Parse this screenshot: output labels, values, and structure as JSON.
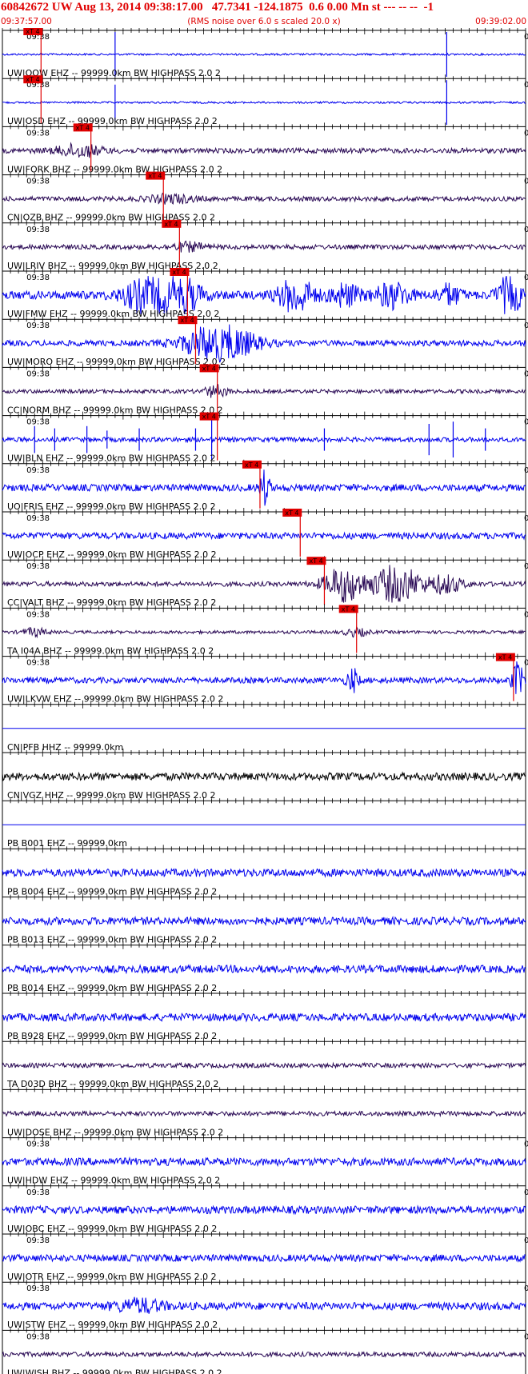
{
  "header": {
    "title": "60842672 UW Aug 13, 2014 09:38:17.00   47.7341 -124.1875  0.6 0.00 Mn st --- -- --  -1",
    "start_time": "09:37:57.00",
    "end_time": "09:39:02.00",
    "subtitle": "(RMS noise over 6.0 s scaled 20.0 x)"
  },
  "chart_data": {
    "type": "seismogram",
    "x_range_seconds": [
      0,
      65
    ],
    "tick_label": "09:38",
    "pick_label": "xT 4",
    "colors": {
      "blue": "#0000ee",
      "dark": "#2a0a55",
      "black": "#000000",
      "pick": "#e00000",
      "axis": "#000000"
    },
    "traces": [
      {
        "label": "UW|OOW EHZ -- 99999.0km BW  HIGHPASS  2.0  2",
        "color": "blue",
        "pick_s": 4.8,
        "amp": 0.05,
        "spikes": [
          [
            14.0,
            1.0
          ],
          [
            55.2,
            1.0
          ]
        ],
        "bursts": []
      },
      {
        "label": "UW|OSD EHZ -- 99999.0km BW  HIGHPASS  2.0  2",
        "color": "blue",
        "pick_s": 4.8,
        "amp": 0.05,
        "spikes": [
          [
            14.0,
            0.8
          ],
          [
            55.2,
            1.0
          ]
        ],
        "bursts": []
      },
      {
        "label": "UW|FORK BHZ -- 99999.0km BW  HIGHPASS  2.0  2",
        "color": "dark",
        "pick_s": 11.0,
        "amp": 0.13,
        "spikes": [],
        "bursts": [
          [
            9.5,
            4.0,
            0.3
          ]
        ]
      },
      {
        "label": "CN|OZB BHZ -- 99999.0km BW  HIGHPASS  2.0  2",
        "color": "dark",
        "pick_s": 20.0,
        "amp": 0.12,
        "spikes": [],
        "bursts": [
          [
            21.0,
            4.0,
            0.2
          ]
        ]
      },
      {
        "label": "UW|LRIV BHZ -- 99999.0km BW  HIGHPASS  2.0  2",
        "color": "dark",
        "pick_s": 22.0,
        "amp": 0.12,
        "spikes": [],
        "bursts": [
          [
            23.0,
            3.0,
            0.2
          ]
        ]
      },
      {
        "label": "UW|FMW EHZ -- 99999.0km BW  HIGHPASS  2.0  2",
        "color": "blue",
        "pick_s": 23.0,
        "amp": 0.22,
        "spikes": [],
        "bursts": [
          [
            18.0,
            4.0,
            0.9
          ],
          [
            22.0,
            3.5,
            1.0
          ],
          [
            36.5,
            3.0,
            0.9
          ],
          [
            42.5,
            2.5,
            0.55
          ],
          [
            48.5,
            3.0,
            0.6
          ],
          [
            55.5,
            2.0,
            0.5
          ],
          [
            63.0,
            2.0,
            1.0
          ]
        ]
      },
      {
        "label": "UW|MORO EHZ -- 99999.0km BW  HIGHPASS  2.0  2",
        "color": "blue",
        "pick_s": 24.0,
        "amp": 0.15,
        "spikes": [],
        "bursts": [
          [
            27.0,
            6.0,
            1.0
          ]
        ]
      },
      {
        "label": "CC|NORM BHZ -- 99999.0km BW  HIGHPASS  2.0  2",
        "color": "dark",
        "pick_s": 26.7,
        "amp": 0.1,
        "spikes": [],
        "bursts": [
          [
            26.5,
            2.0,
            0.3
          ]
        ]
      },
      {
        "label": "UW|BLN EHZ -- 99999.0km BW  HIGHPASS  2.0  2",
        "color": "blue",
        "pick_s": 26.7,
        "amp": 0.12,
        "spikes": [
          [
            4.0,
            0.6
          ],
          [
            6.5,
            0.5
          ],
          [
            10.5,
            0.6
          ],
          [
            13.0,
            0.4
          ],
          [
            17.0,
            0.5
          ],
          [
            24.0,
            0.5
          ],
          [
            26.0,
            0.9
          ],
          [
            40.0,
            0.5
          ],
          [
            53.0,
            0.7
          ],
          [
            56.0,
            0.8
          ],
          [
            60.0,
            0.5
          ]
        ],
        "bursts": []
      },
      {
        "label": "UO|FRIS EHZ -- 99999.0km BW  HIGHPASS  2.0  2",
        "color": "blue",
        "pick_s": 32.0,
        "amp": 0.18,
        "spikes": [],
        "bursts": [
          [
            32.6,
            0.8,
            1.0
          ]
        ]
      },
      {
        "label": "UW|OCP EHZ -- 99999.0km BW  HIGHPASS  2.0  2",
        "color": "blue",
        "pick_s": 37.0,
        "amp": 0.17,
        "spikes": [],
        "bursts": []
      },
      {
        "label": "CC|VALT BHZ -- 99999.0km BW  HIGHPASS  2.0  2",
        "color": "dark",
        "pick_s": 40.0,
        "amp": 0.12,
        "spikes": [],
        "bursts": [
          [
            42.5,
            3.5,
            0.9
          ],
          [
            49.0,
            4.0,
            1.0
          ],
          [
            55.0,
            3.0,
            0.45
          ]
        ]
      },
      {
        "label": "TA I04A BHZ -- 99999.0km BW  HIGHPASS  2.0  2",
        "color": "dark",
        "pick_s": 44.0,
        "amp": 0.08,
        "spikes": [],
        "bursts": [
          [
            4.0,
            2.0,
            0.2
          ],
          [
            44.0,
            2.0,
            0.2
          ]
        ]
      },
      {
        "label": "UW|LKVW EHZ -- 99999.0km BW  HIGHPASS  2.0  2",
        "color": "blue",
        "pick_s": 63.5,
        "amp": 0.15,
        "spikes": [],
        "bursts": [
          [
            43.5,
            1.0,
            0.6
          ],
          [
            64.0,
            1.0,
            0.9
          ]
        ]
      },
      {
        "label": "CN|PFB HHZ -- 99999.0km",
        "color": "blue",
        "pick_s": null,
        "amp": 0.0,
        "spikes": [],
        "bursts": [],
        "hide_tick": true
      },
      {
        "label": "CN|VGZ HHZ -- 99999.0km BW  HIGHPASS  2.0  2",
        "color": "black",
        "pick_s": null,
        "amp": 0.2,
        "spikes": [],
        "bursts": [],
        "hide_tick": true
      },
      {
        "label": "PB B001 EHZ -- 99999.0km",
        "color": "blue",
        "pick_s": null,
        "amp": 0.0,
        "spikes": [],
        "bursts": [],
        "hide_tick": true
      },
      {
        "label": "PB B004 EHZ -- 99999.0km BW  HIGHPASS  2.0  2",
        "color": "blue",
        "pick_s": null,
        "amp": 0.2,
        "spikes": [],
        "bursts": [],
        "hide_tick": true
      },
      {
        "label": "PB B013 EHZ -- 99999.0km BW  HIGHPASS  2.0  2",
        "color": "blue",
        "pick_s": null,
        "amp": 0.2,
        "spikes": [],
        "bursts": [],
        "hide_tick": true
      },
      {
        "label": "PB B014 EHZ -- 99999.0km BW  HIGHPASS  2.0  2",
        "color": "blue",
        "pick_s": null,
        "amp": 0.2,
        "spikes": [],
        "bursts": [],
        "hide_tick": true
      },
      {
        "label": "PB B928 EHZ -- 99999.0km BW  HIGHPASS  2.0  2",
        "color": "blue",
        "pick_s": null,
        "amp": 0.2,
        "spikes": [],
        "bursts": [],
        "hide_tick": true
      },
      {
        "label": "TA D03D BHZ -- 99999.0km BW  HIGHPASS  2.0  2",
        "color": "dark",
        "pick_s": null,
        "amp": 0.12,
        "spikes": [],
        "bursts": [],
        "hide_tick": true
      },
      {
        "label": "UW|DOSE BHZ -- 99999.0km BW  HIGHPASS  2.0  2",
        "color": "dark",
        "pick_s": null,
        "amp": 0.12,
        "spikes": [],
        "bursts": [],
        "hide_tick": true
      },
      {
        "label": "UW|HDW EHZ -- 99999.0km BW  HIGHPASS  2.0  2",
        "color": "blue",
        "pick_s": null,
        "amp": 0.2,
        "spikes": [],
        "bursts": []
      },
      {
        "label": "UW|OBC EHZ -- 99999.0km BW  HIGHPASS  2.0  2",
        "color": "blue",
        "pick_s": null,
        "amp": 0.2,
        "spikes": [],
        "bursts": []
      },
      {
        "label": "UW|OTR EHZ -- 99999.0km BW  HIGHPASS  2.0  2",
        "color": "blue",
        "pick_s": null,
        "amp": 0.18,
        "spikes": [],
        "bursts": []
      },
      {
        "label": "UW|STW EHZ -- 99999.0km BW  HIGHPASS  2.0  2",
        "color": "blue",
        "pick_s": null,
        "amp": 0.2,
        "spikes": [],
        "bursts": [
          [
            17.0,
            4.0,
            0.3
          ]
        ]
      },
      {
        "label": "UW|WISH BHZ -- 99999.0km BW  HIGHPASS  2.0  2",
        "color": "dark",
        "pick_s": null,
        "amp": 0.12,
        "spikes": [],
        "bursts": []
      }
    ]
  }
}
